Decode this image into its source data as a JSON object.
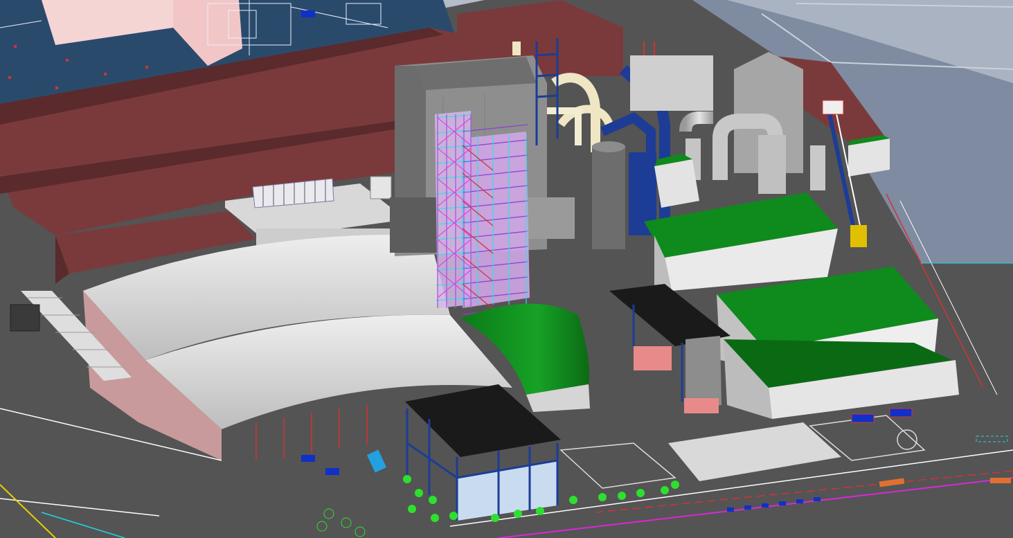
{
  "viewport": {
    "kind": "3d-plant-model-view",
    "sky_color_top": "#b4bdc9",
    "sky_color_bottom": "#8a96a8",
    "ground_color": "#545454",
    "site_plan_color": "#2a4a6c"
  },
  "colors": {
    "roof_maroon": "#7a3a3b",
    "roof_maroon_dark": "#5b2a2c",
    "shed_white": "#d9d9d9",
    "shed_shadow": "#b3b3b3",
    "wall_pink": "#c99a9b",
    "boiler_grey": "#8e8e8e",
    "boiler_dark": "#6c6c6c",
    "steel_purple": "#c79bdc",
    "steel_cyan": "#33e0e6",
    "duct_blue": "#1c3c96",
    "pipe_cream": "#efe6c4",
    "green_roof": "#0f8a1c",
    "green_roof_dark": "#0a6a14",
    "black_roof": "#1a1a1a",
    "glass_blue": "#c9dcef",
    "chimney_grey": "#c5c5c5",
    "line_red": "#d23333",
    "line_cyan": "#23d5e5",
    "line_magenta": "#d72ad7",
    "plant_green": "#2ee02e",
    "vehicle_blue": "#1030c8"
  }
}
